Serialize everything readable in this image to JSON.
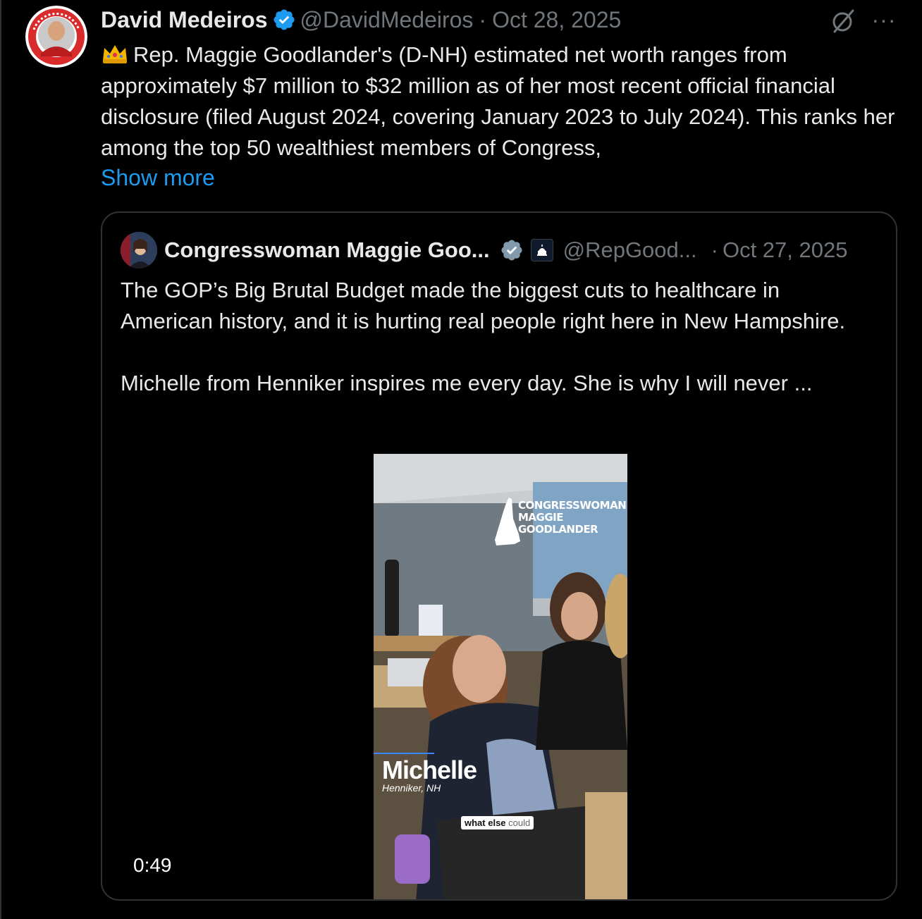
{
  "tweet": {
    "author_name": "David Medeiros",
    "author_handle": "@DavidMedeiros",
    "separator": "·",
    "date": "Oct 28, 2025",
    "more_label": "···",
    "text": "Rep. Maggie Goodlander's (D-NH) estimated net worth ranges from approximately $7 million to $32 million as of her most recent official financial disclosure (filed August 2024, covering January 2023 to July 2024). This ranks her among the top 50 wealthiest members of Congress,",
    "show_more": "Show more",
    "icons": [
      "avatar",
      "verified-badge-icon",
      "crown-emoji-icon",
      "grok-icon",
      "more-icon"
    ]
  },
  "quote": {
    "author_name": "Congresswoman Maggie Goo...",
    "author_handle": "@RepGood...",
    "separator": "·",
    "date": "Oct 27, 2025",
    "text": "The GOP’s Big Brutal Budget made the biggest cuts to healthcare in American history, and it is hurting real people right here in New Hampshire.\n\nMichelle from Henniker inspires me every day. She is why I will never ...",
    "video": {
      "logo_lines": "CONGRESSWOMAN\nMAGGIE\nGOODLANDER",
      "lower_third_name": "Michelle",
      "lower_third_place": "Henniker, NH",
      "caption_main": "what else",
      "caption_dim": "could",
      "duration": "0:49"
    }
  },
  "colors": {
    "background": "#000000",
    "text": "#e7e9ea",
    "muted": "#71767b",
    "link": "#1d9bf0",
    "border": "#2f3336",
    "verified_blue": "#1d9bf0",
    "verified_gray": "#829aab"
  }
}
